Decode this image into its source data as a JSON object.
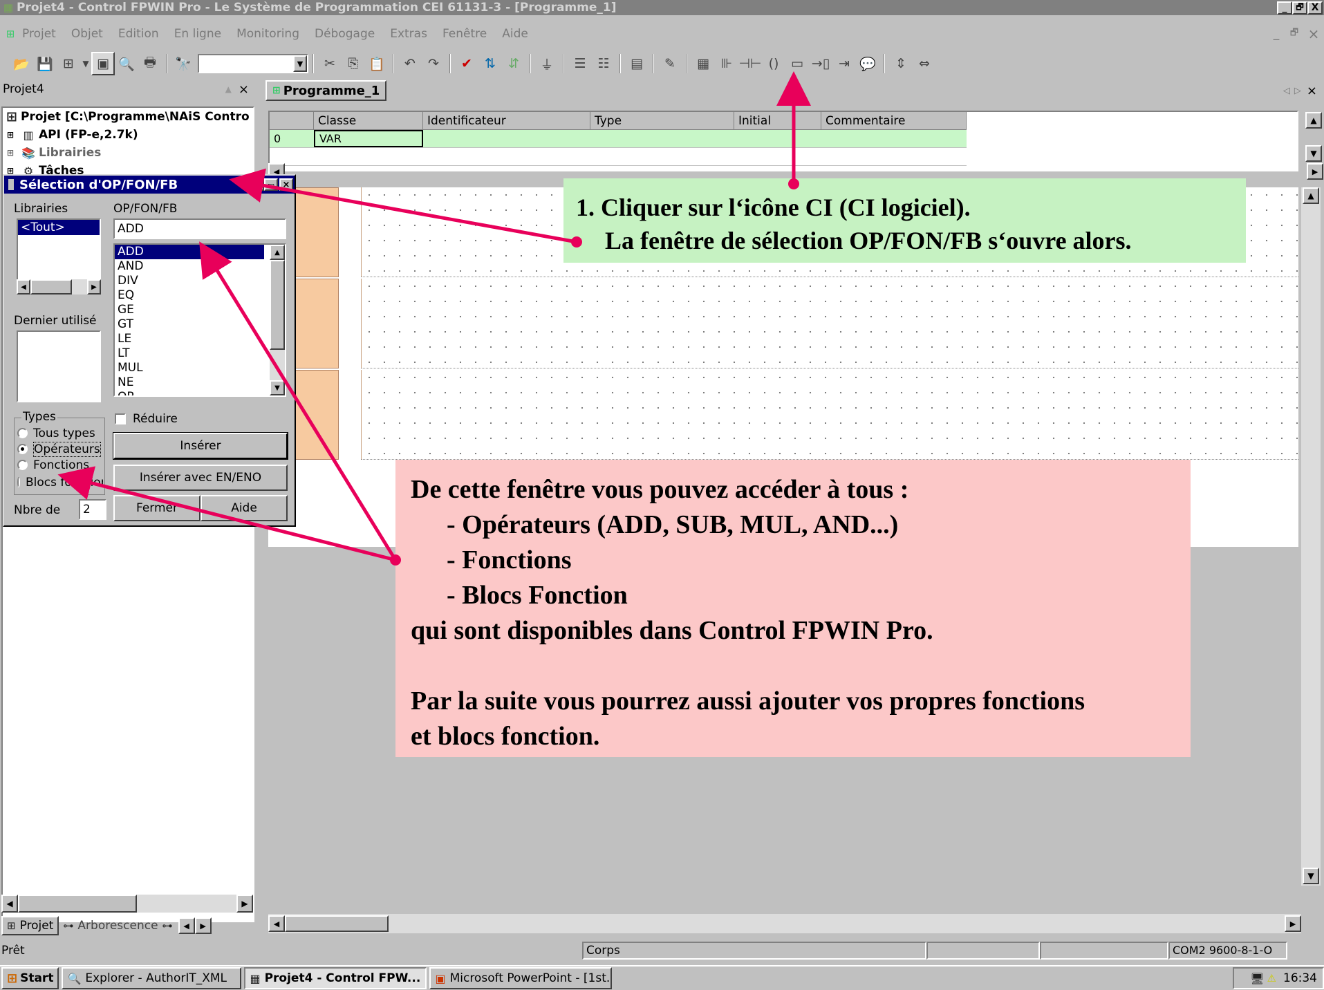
{
  "window": {
    "title": "Projet4 - Control FPWIN Pro - Le Système de Programmation CEI 61131-3 - [Programme_1]",
    "caption_buttons": [
      "_",
      "🗗",
      "X"
    ]
  },
  "menu": {
    "items": [
      "Projet",
      "Objet",
      "Edition",
      "En ligne",
      "Monitoring",
      "Débogage",
      "Extras",
      "Fenêtre",
      "Aide"
    ],
    "mdi_controls": [
      "_",
      "🗗",
      "×"
    ]
  },
  "toolbar": {
    "icons": [
      "open-icon",
      "save-icon",
      "network-icon",
      "window-icon",
      "print-preview-icon",
      "print-icon",
      "find-icon"
    ],
    "combo_value": "",
    "icons2": [
      "cut-icon",
      "copy-icon",
      "paste-icon",
      "undo-icon",
      "redo-icon",
      "check-icon",
      "compile-icon",
      "build-icon",
      "download-icon",
      "insert-network-before-icon",
      "insert-network-after-icon",
      "network-label-icon",
      "edit-icon",
      "var-icon",
      "ci-icon",
      "contact-icon",
      "coil-icon",
      "var-box-icon",
      "jump-icon",
      "return-icon",
      "comment-icon",
      "vertical-size-icon",
      "horizontal-size-icon"
    ]
  },
  "left_panel": {
    "title": "Projet4",
    "tree": [
      {
        "label": "Projet [C:\\Programme\\NAiS Contro",
        "icon": "project-icon"
      },
      {
        "label": "API (FP-e,2.7k)",
        "icon": "plc-icon"
      },
      {
        "label": "Librairies",
        "icon": "library-icon"
      },
      {
        "label": "Tâches",
        "icon": "tasks-icon"
      }
    ],
    "bottom_tabs": [
      "Projet",
      "Arborescence"
    ]
  },
  "dialog": {
    "title": "Sélection d'OP/FON/FB",
    "libraries_label": "Librairies",
    "libraries": [
      "<Tout>"
    ],
    "opfonfb_label": "OP/FON/FB",
    "search_value": "ADD",
    "items": [
      "ADD",
      "AND",
      "DIV",
      "EQ",
      "GE",
      "GT",
      "LE",
      "LT",
      "MUL",
      "NE",
      "OR"
    ],
    "selected_item": "ADD",
    "last_used_label": "Dernier utilisé",
    "types_label": "Types",
    "type_options": [
      "Tous types",
      "Opérateurs",
      "Fonctions",
      "Blocs fonction"
    ],
    "selected_type": "Opérateurs",
    "reduce_label": "Réduire",
    "insert_button": "Insérer",
    "insert_en_button": "Insérer avec EN/ENO",
    "close_button": "Fermer",
    "help_button": "Aide",
    "count_label": "Nbre de",
    "count_value": "2"
  },
  "editor": {
    "tab_label": "Programme_1",
    "columns": [
      "Classe",
      "Identificateur",
      "Type",
      "Initial",
      "Commentaire"
    ],
    "rows": [
      {
        "index": "0",
        "class": "VAR",
        "identifier": "",
        "type": "",
        "initial": "",
        "comment": ""
      }
    ]
  },
  "callout1": {
    "line1": "1. Cliquer sur l‘icône CI (CI logiciel).",
    "line2": "La fenêtre de sélection OP/FON/FB s‘ouvre alors."
  },
  "callout2": {
    "line1": "De cette fenêtre vous pouvez accéder à tous :",
    "line2": "- Opérateurs (ADD, SUB, MUL, AND...)",
    "line3": "- Fonctions",
    "line4": "- Blocs Fonction",
    "line5": "qui sont disponibles dans Control FPWIN Pro.",
    "line6": "Par la suite vous pourrez aussi ajouter vos propres fonctions",
    "line7": "et blocs fonction."
  },
  "statusbar": {
    "left": "Prêt",
    "middle": "Corps",
    "right": "COM2 9600-8-1-O"
  },
  "taskbar": {
    "start": "Start",
    "tasks": [
      "Explorer - AuthorIT_XML",
      "Projet4 - Control FPW...",
      "Microsoft PowerPoint - [1st..."
    ],
    "clock": "16:34"
  },
  "colors": {
    "callout_green": "#c6f2c2",
    "callout_pink": "#fcc8c8",
    "arrow": "#e8005a",
    "rail": "#f7caa0",
    "selection": "#00007b"
  }
}
